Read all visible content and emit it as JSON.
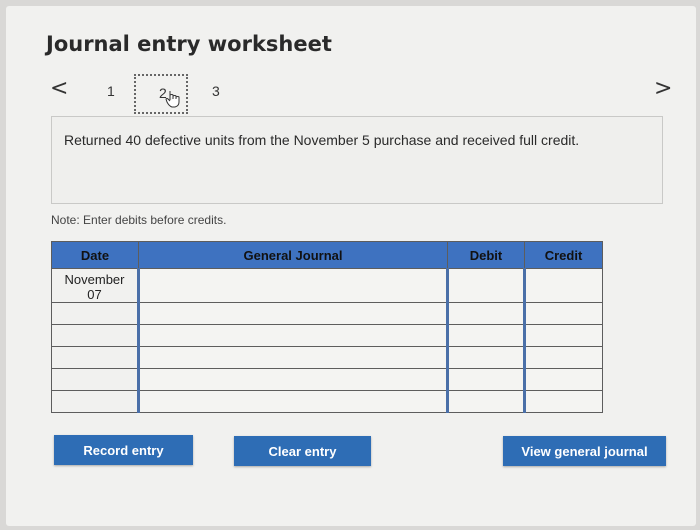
{
  "header": {
    "title": "Journal entry worksheet"
  },
  "pagination": {
    "prev_icon": "chevron-left-icon",
    "next_icon": "chevron-right-icon",
    "prev_glyph": "<",
    "next_glyph": ">",
    "pages": [
      "1",
      "2",
      "3"
    ],
    "current_page": "2"
  },
  "prompt": {
    "text": "Returned 40 defective units from the November 5 purchase and received full credit."
  },
  "note": "Note: Enter debits before credits.",
  "table": {
    "headers": {
      "date": "Date",
      "journal": "General Journal",
      "debit": "Debit",
      "credit": "Credit"
    },
    "rows": [
      {
        "date_line1": "November",
        "date_line2": "07",
        "journal": "",
        "debit": "",
        "credit": ""
      },
      {
        "date_line1": "",
        "date_line2": "",
        "journal": "",
        "debit": "",
        "credit": ""
      },
      {
        "date_line1": "",
        "date_line2": "",
        "journal": "",
        "debit": "",
        "credit": ""
      },
      {
        "date_line1": "",
        "date_line2": "",
        "journal": "",
        "debit": "",
        "credit": ""
      },
      {
        "date_line1": "",
        "date_line2": "",
        "journal": "",
        "debit": "",
        "credit": ""
      },
      {
        "date_line1": "",
        "date_line2": "",
        "journal": "",
        "debit": "",
        "credit": ""
      }
    ]
  },
  "buttons": {
    "record": "Record entry",
    "clear": "Clear entry",
    "view": "View general journal"
  },
  "colors": {
    "accent": "#2e6db5",
    "table_header": "#3e72c0"
  }
}
